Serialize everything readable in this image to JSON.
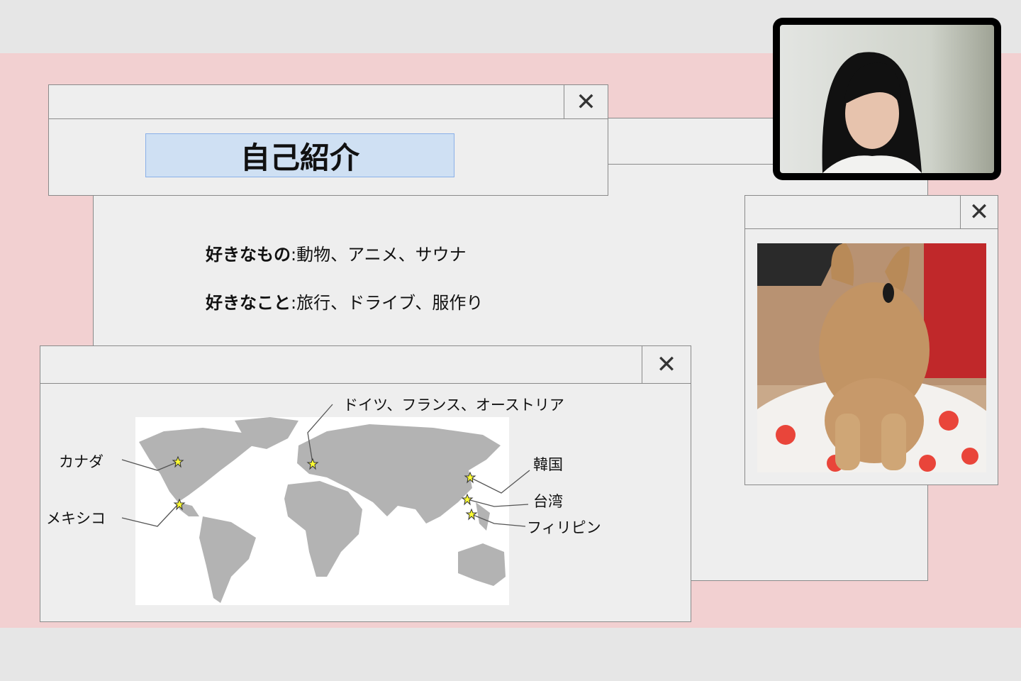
{
  "slide": {
    "title": "自己紹介",
    "likes_label": "好きなもの",
    "likes_value": ":動物、アニメ、サウナ",
    "hobbies_label": "好きなこと",
    "hobbies_value": ":旅行、ドライブ、服作り"
  },
  "map": {
    "labels": {
      "europe": "ドイツ、フランス、オーストリア",
      "canada": "カナダ",
      "mexico": "メキシコ",
      "korea": "韓国",
      "taiwan": "台湾",
      "philippines": "フィリピン"
    }
  },
  "icons": {
    "close": "close-icon",
    "star": "star-icon"
  },
  "colors": {
    "pink_bg": "#f2d0d1",
    "window_bg": "#eeeeee",
    "title_highlight": "#cfe0f3",
    "map_land": "#b3b3b3",
    "star": "#ffff33"
  },
  "close_glyph": "✕"
}
